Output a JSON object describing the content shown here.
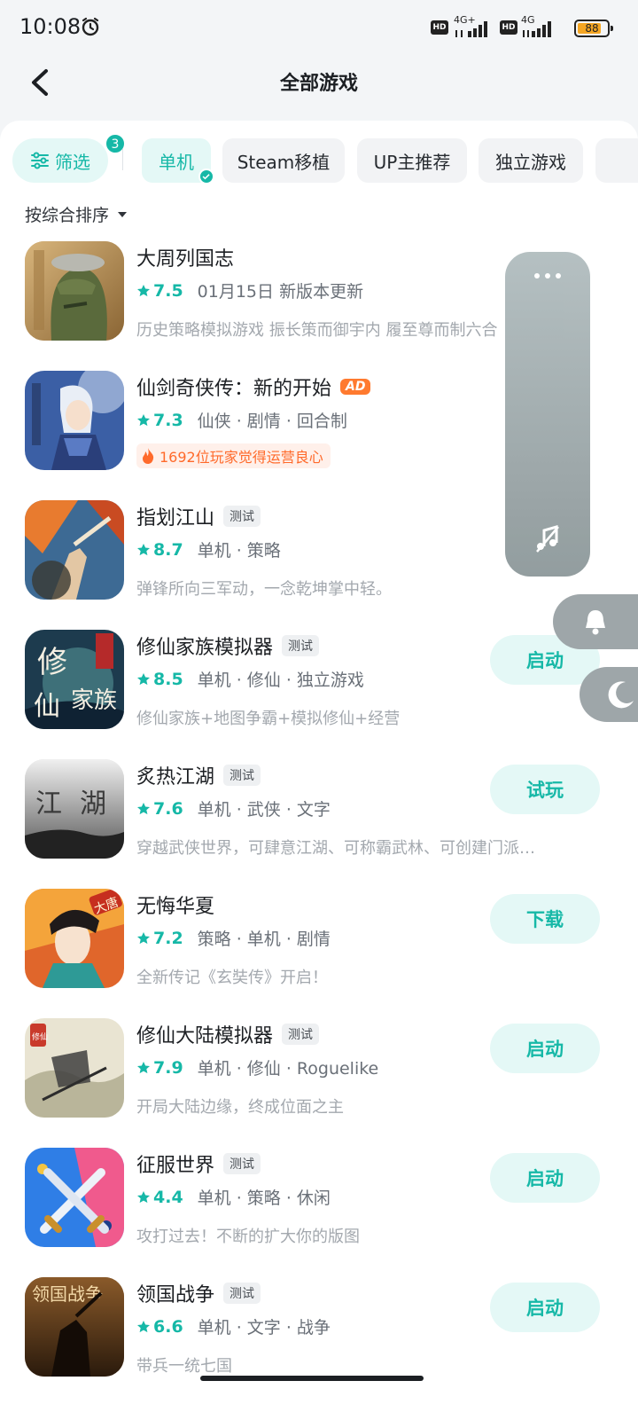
{
  "status_bar": {
    "time": "10:08",
    "hd1": "HD",
    "net1": "4G+",
    "hd2": "HD",
    "net2": "4G",
    "battery": "88"
  },
  "header": {
    "title": "全部游戏",
    "back_icon": "chevron-left-icon"
  },
  "filters": {
    "filter_label": "筛选",
    "filter_count": "3",
    "chips": [
      "单机",
      "Steam移植",
      "UP主推荐",
      "独立游戏"
    ],
    "active_chip": "单机"
  },
  "sort": {
    "label": "按综合排序"
  },
  "games": [
    {
      "name": "大周列国志",
      "badge": "",
      "rating": "7.5",
      "meta": "01月15日 新版本更新",
      "desc": "历史策略模拟游戏 振长策而御宇内 履至尊而制六合",
      "highlight": "",
      "action": ""
    },
    {
      "name": "仙剑奇侠传：新的开始",
      "badge": "AD",
      "rating": "7.3",
      "meta": "仙侠 · 剧情 · 回合制",
      "desc": "",
      "highlight": "1692位玩家觉得运营良心",
      "action": ""
    },
    {
      "name": "指划江山",
      "badge": "测试",
      "rating": "8.7",
      "meta": "单机 · 策略",
      "desc": "弹锋所向三军动，一念乾坤掌中轻。",
      "highlight": "",
      "action": ""
    },
    {
      "name": "修仙家族模拟器",
      "badge": "测试",
      "rating": "8.5",
      "meta": "单机 · 修仙 · 独立游戏",
      "desc": "修仙家族+地图争霸+模拟修仙+经营",
      "highlight": "",
      "action": "启动"
    },
    {
      "name": "炙热江湖",
      "badge": "测试",
      "rating": "7.6",
      "meta": "单机 · 武侠 · 文字",
      "desc": "穿越武侠世界，可肆意江湖、可称霸武林、可创建门派…",
      "highlight": "",
      "action": "试玩"
    },
    {
      "name": "无悔华夏",
      "badge": "",
      "rating": "7.2",
      "meta": "策略 · 单机 · 剧情",
      "desc": "全新传记《玄奘传》开启！",
      "highlight": "",
      "action": "下载"
    },
    {
      "name": "修仙大陆模拟器",
      "badge": "测试",
      "rating": "7.9",
      "meta": "单机 · 修仙 · Roguelike",
      "desc": "开局大陆边缘，终成位面之主",
      "highlight": "",
      "action": "启动"
    },
    {
      "name": "征服世界",
      "badge": "测试",
      "rating": "4.4",
      "meta": "单机 · 策略 · 休闲",
      "desc": "攻打过去！不断的扩大你的版图",
      "highlight": "",
      "action": "启动"
    },
    {
      "name": "领国战争",
      "badge": "测试",
      "rating": "6.6",
      "meta": "单机 · 文字 · 战争",
      "desc": "带兵一统七国",
      "highlight": "",
      "action": "启动"
    }
  ],
  "icon_art": {
    "g3": "修仙\n家族",
    "g4": "江湖",
    "g5": "大唐",
    "g6": "修仙",
    "g8": "领国战争"
  },
  "colors": {
    "accent": "#16b8a7",
    "accent_bg": "#e4f8f6",
    "ad": "#ff7a2f"
  }
}
